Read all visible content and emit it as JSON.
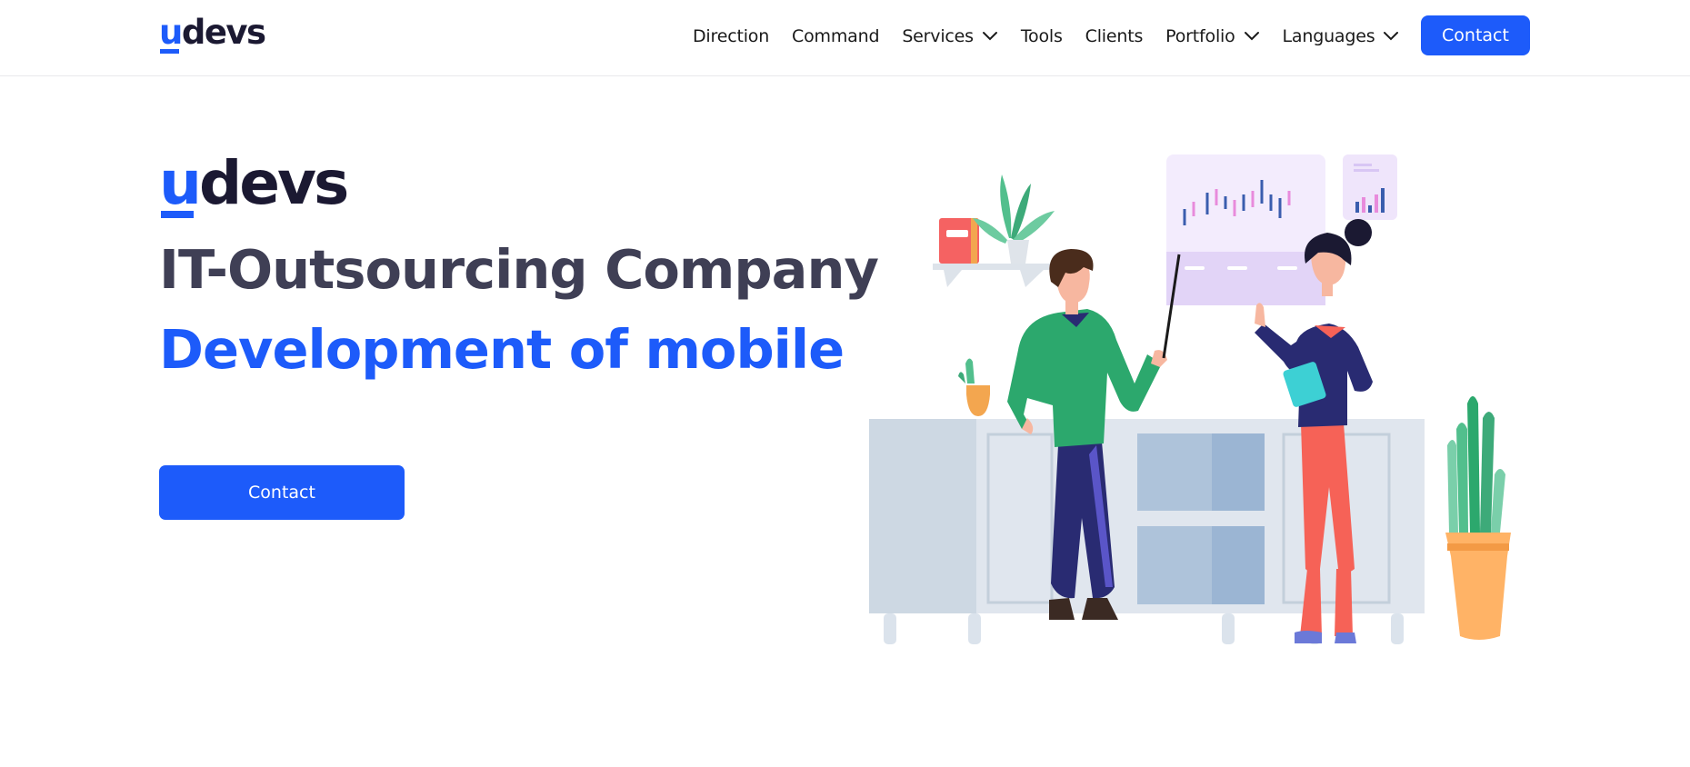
{
  "header": {
    "logo_text": "udevs",
    "nav": [
      {
        "label": "Direction",
        "has_dropdown": false
      },
      {
        "label": "Command",
        "has_dropdown": false
      },
      {
        "label": "Services",
        "has_dropdown": true
      },
      {
        "label": "Tools",
        "has_dropdown": false
      },
      {
        "label": "Clients",
        "has_dropdown": false
      },
      {
        "label": "Portfolio",
        "has_dropdown": true
      },
      {
        "label": "Languages",
        "has_dropdown": true
      }
    ],
    "contact_label": "Contact"
  },
  "hero": {
    "logo_text": "udevs",
    "title": "IT-Outsourcing Company",
    "subtitle": "Development of mobile",
    "contact_label": "Contact"
  },
  "colors": {
    "brand_blue": "#1d5bfa",
    "logo_dark": "#1b1932",
    "title_gray": "#3f3f55"
  },
  "icons": {
    "dropdown": "chevron-down-icon"
  }
}
